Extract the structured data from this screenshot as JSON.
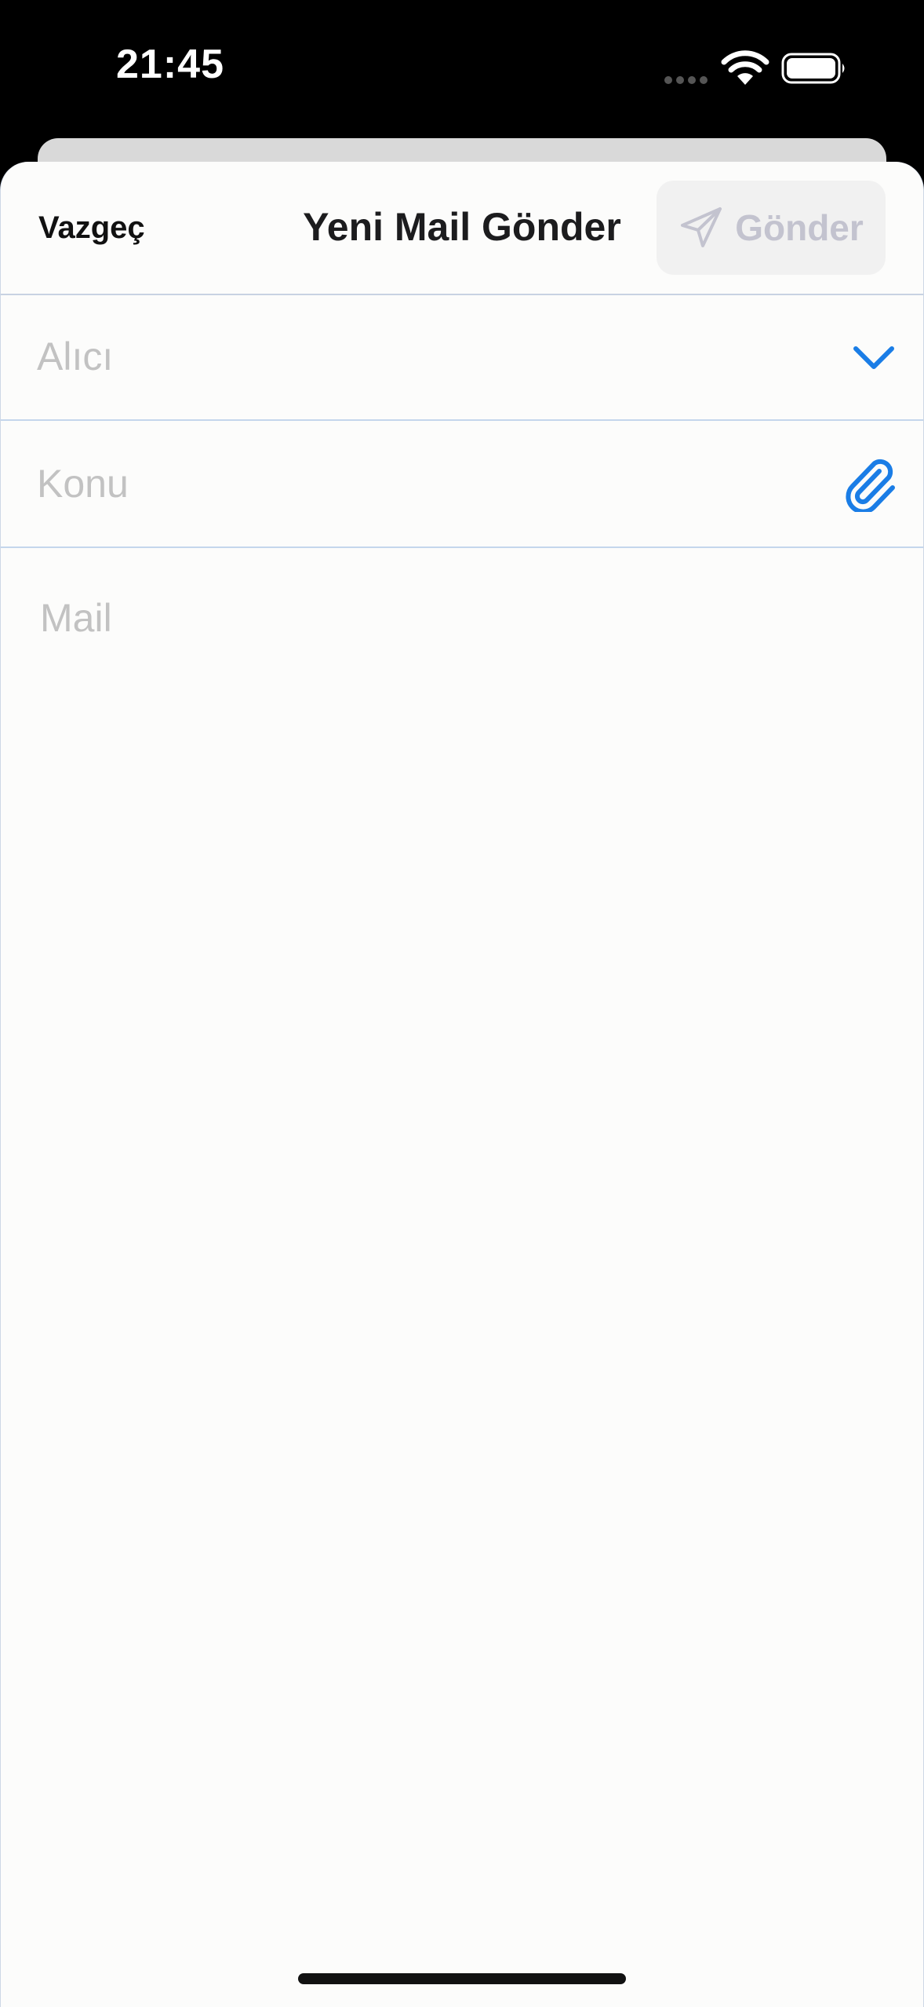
{
  "status_bar": {
    "time": "21:45",
    "icons": [
      "cellular-dots-icon",
      "wifi-icon",
      "battery-icon"
    ]
  },
  "nav": {
    "cancel_label": "Vazgeç",
    "title": "Yeni Mail Gönder",
    "send_label": "Gönder",
    "send_icon": "paper-plane-icon"
  },
  "form": {
    "recipient_placeholder": "Alıcı",
    "recipient_value": "",
    "recipient_icon": "chevron-down-icon",
    "subject_placeholder": "Konu",
    "subject_value": "",
    "subject_icon": "paperclip-icon",
    "body_placeholder": "Mail",
    "body_value": ""
  },
  "colors": {
    "accent": "#1a7de6",
    "placeholder": "#c2c2c2",
    "send_disabled_text": "#c3c3cf",
    "divider": "#c4d6ec",
    "sheet_background": "#fcfcfb"
  }
}
